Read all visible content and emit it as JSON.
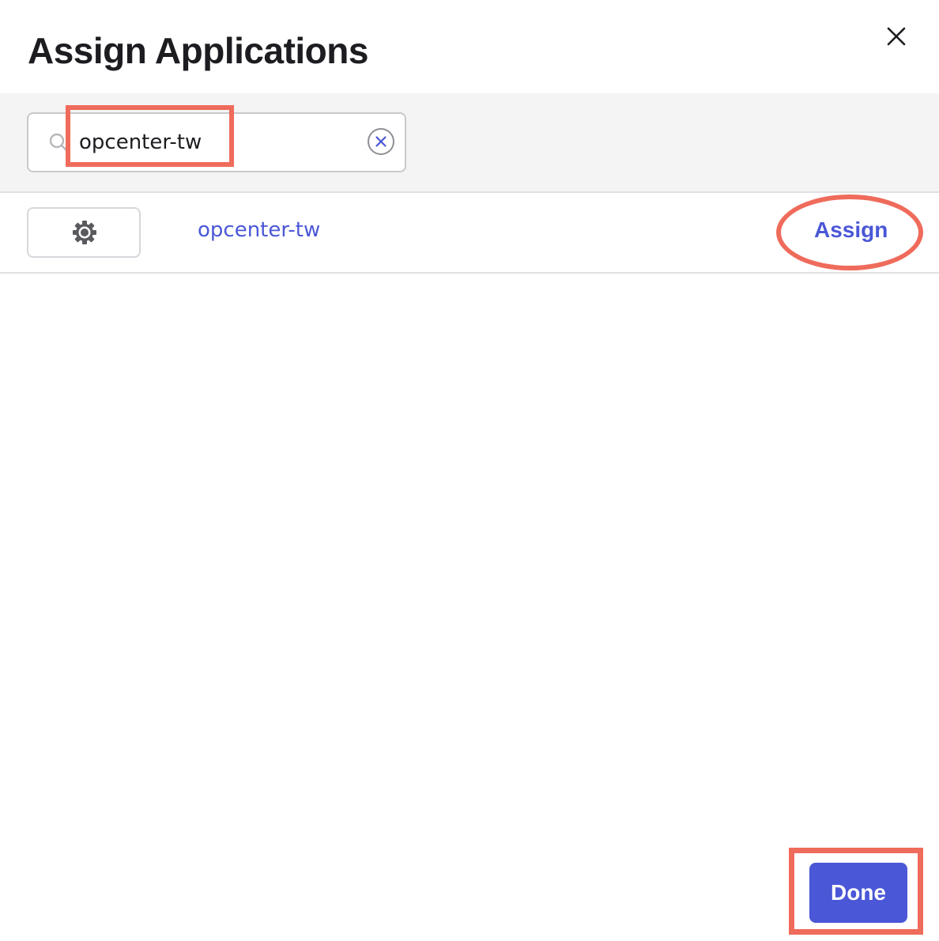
{
  "dialog": {
    "title": "Assign Applications",
    "close_icon": "close-icon"
  },
  "search": {
    "value": "opcenter-tw",
    "search_icon": "search-icon",
    "clear_icon": "clear-circle-icon"
  },
  "results": [
    {
      "logo_icon": "gear-icon",
      "name": "opcenter-tw",
      "action_label": "Assign"
    }
  ],
  "footer": {
    "done_label": "Done"
  },
  "colors": {
    "accent": "#4a57d6",
    "annotation": "#ef6b5b",
    "search_band": "#f4f4f4"
  }
}
